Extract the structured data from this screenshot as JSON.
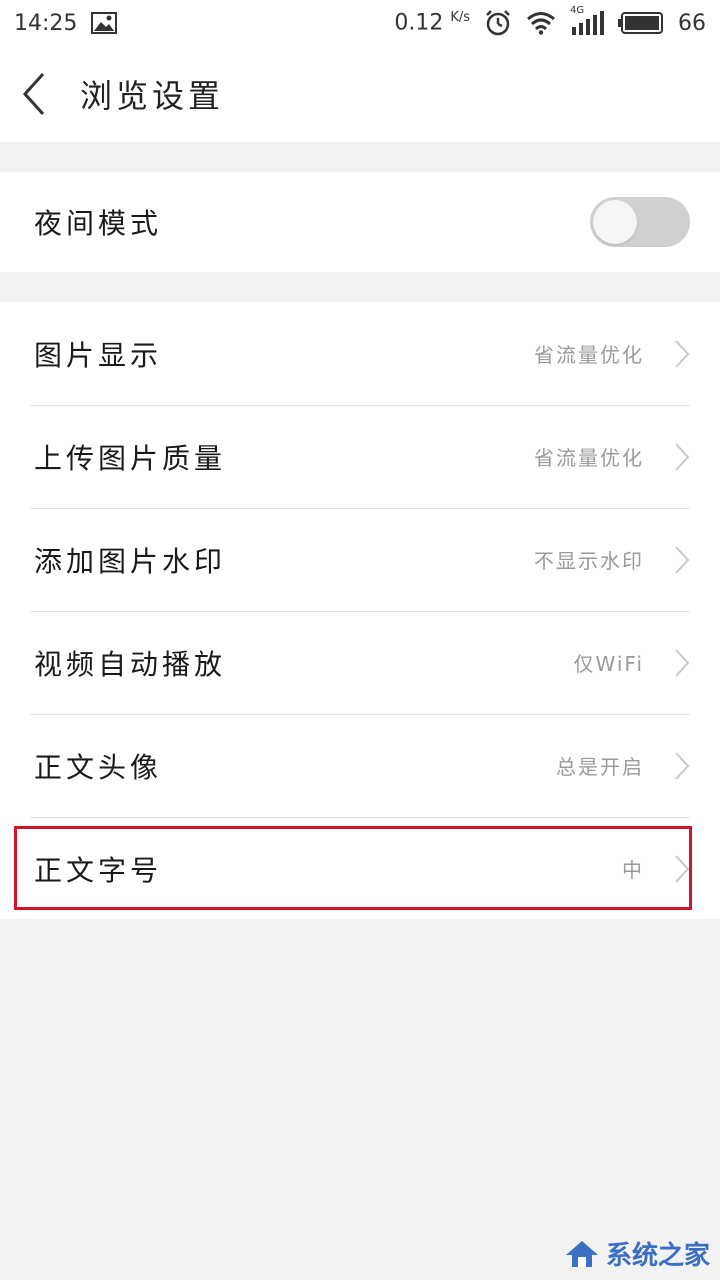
{
  "status_bar": {
    "time": "14:25",
    "speed": "0.12",
    "speed_unit": "K/s",
    "network": "4G",
    "battery": "66"
  },
  "header": {
    "title": "浏览设置"
  },
  "night_mode": {
    "label": "夜间模式",
    "enabled": false
  },
  "settings": [
    {
      "label": "图片显示",
      "value": "省流量优化"
    },
    {
      "label": "上传图片质量",
      "value": "省流量优化"
    },
    {
      "label": "添加图片水印",
      "value": "不显示水印"
    },
    {
      "label": "视频自动播放",
      "value": "仅WiFi"
    },
    {
      "label": "正文头像",
      "value": "总是开启"
    },
    {
      "label": "正文字号",
      "value": "中"
    }
  ],
  "watermark": {
    "text": "系统之家"
  },
  "colors": {
    "highlight": "#d5122a",
    "toggle_off": "#cfd1d1",
    "watermark": "#3a6fc4"
  }
}
